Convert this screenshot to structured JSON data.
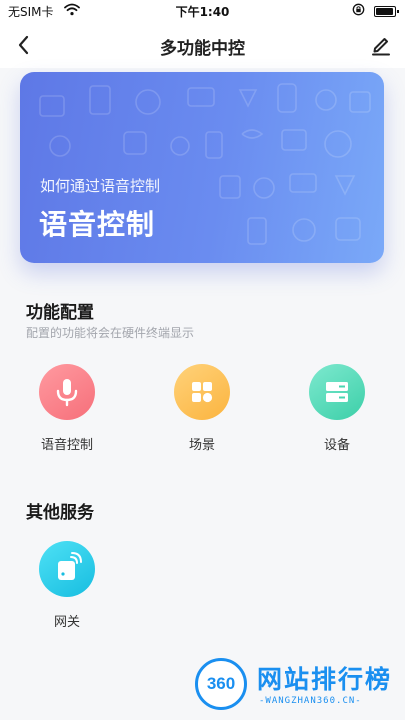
{
  "status_bar": {
    "carrier": "无SIM卡",
    "time": "下午1:40"
  },
  "nav": {
    "title": "多功能中控",
    "back_icon": "chevron-left-icon",
    "edit_icon": "pencil-icon"
  },
  "banner": {
    "subtitle": "如何通过语音控制",
    "heading": "语音控制"
  },
  "function_config": {
    "title": "功能配置",
    "description": "配置的功能将会在硬件终端显示",
    "items": [
      {
        "label": "语音控制",
        "icon": "microphone-icon",
        "color": "#f87a84"
      },
      {
        "label": "场景",
        "icon": "grid-icon",
        "color": "#fcbf52"
      },
      {
        "label": "设备",
        "icon": "device-icon",
        "color": "#48d6b1"
      }
    ]
  },
  "other_services": {
    "title": "其他服务",
    "items": [
      {
        "label": "网关",
        "icon": "gateway-icon",
        "color": "#22c4e6"
      }
    ]
  },
  "watermark": {
    "logo_text": "360",
    "brand": "网站排行榜",
    "domain": "-WANGZHAN360.CN-"
  }
}
